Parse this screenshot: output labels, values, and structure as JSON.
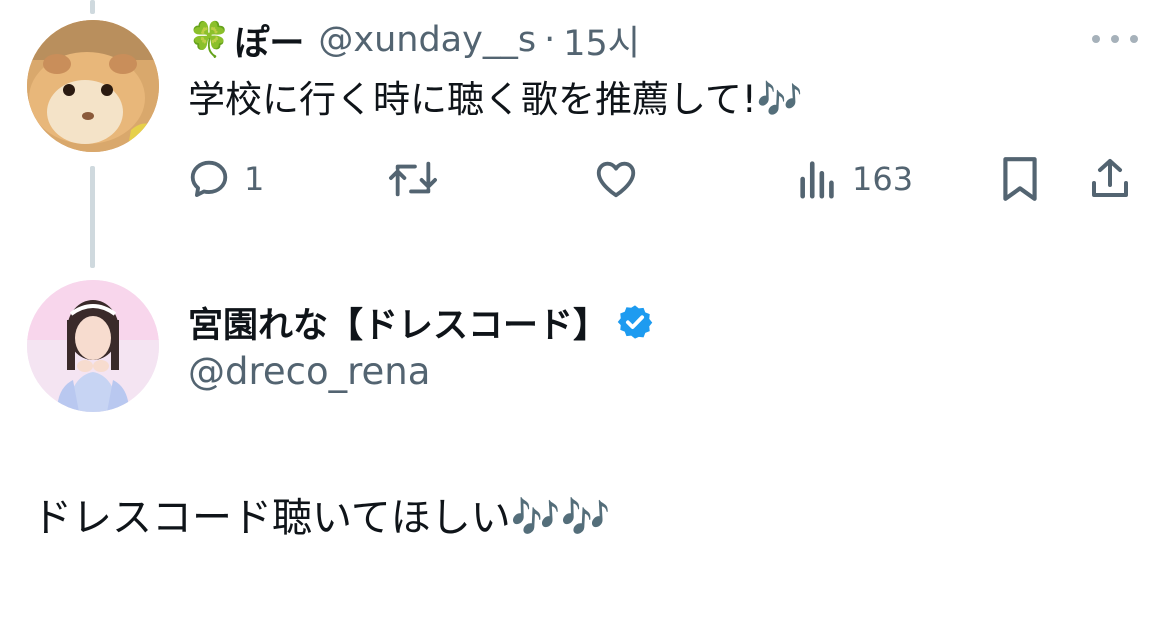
{
  "tweet1": {
    "clover_emoji": "🍀",
    "display_name": "ぽー",
    "handle": "@xunday__s",
    "separator": "·",
    "time": "15시",
    "text": "学校に行く時に聴く歌を推薦して!🎶",
    "reply_count": "1",
    "views_count": "163",
    "avatar_icon": "guinea-pig-avatar"
  },
  "tweet2": {
    "display_name": "宮園れな【ドレスコード】",
    "handle": "@dreco_rena",
    "verified_color": "#1d9bf0",
    "text": "ドレスコード聴いてほしい🎶🎶",
    "avatar_icon": "profile-photo-avatar"
  },
  "colors": {
    "secondary_text": "#536471",
    "thread_line": "#cfd9de",
    "primary_text": "#0f1419"
  }
}
